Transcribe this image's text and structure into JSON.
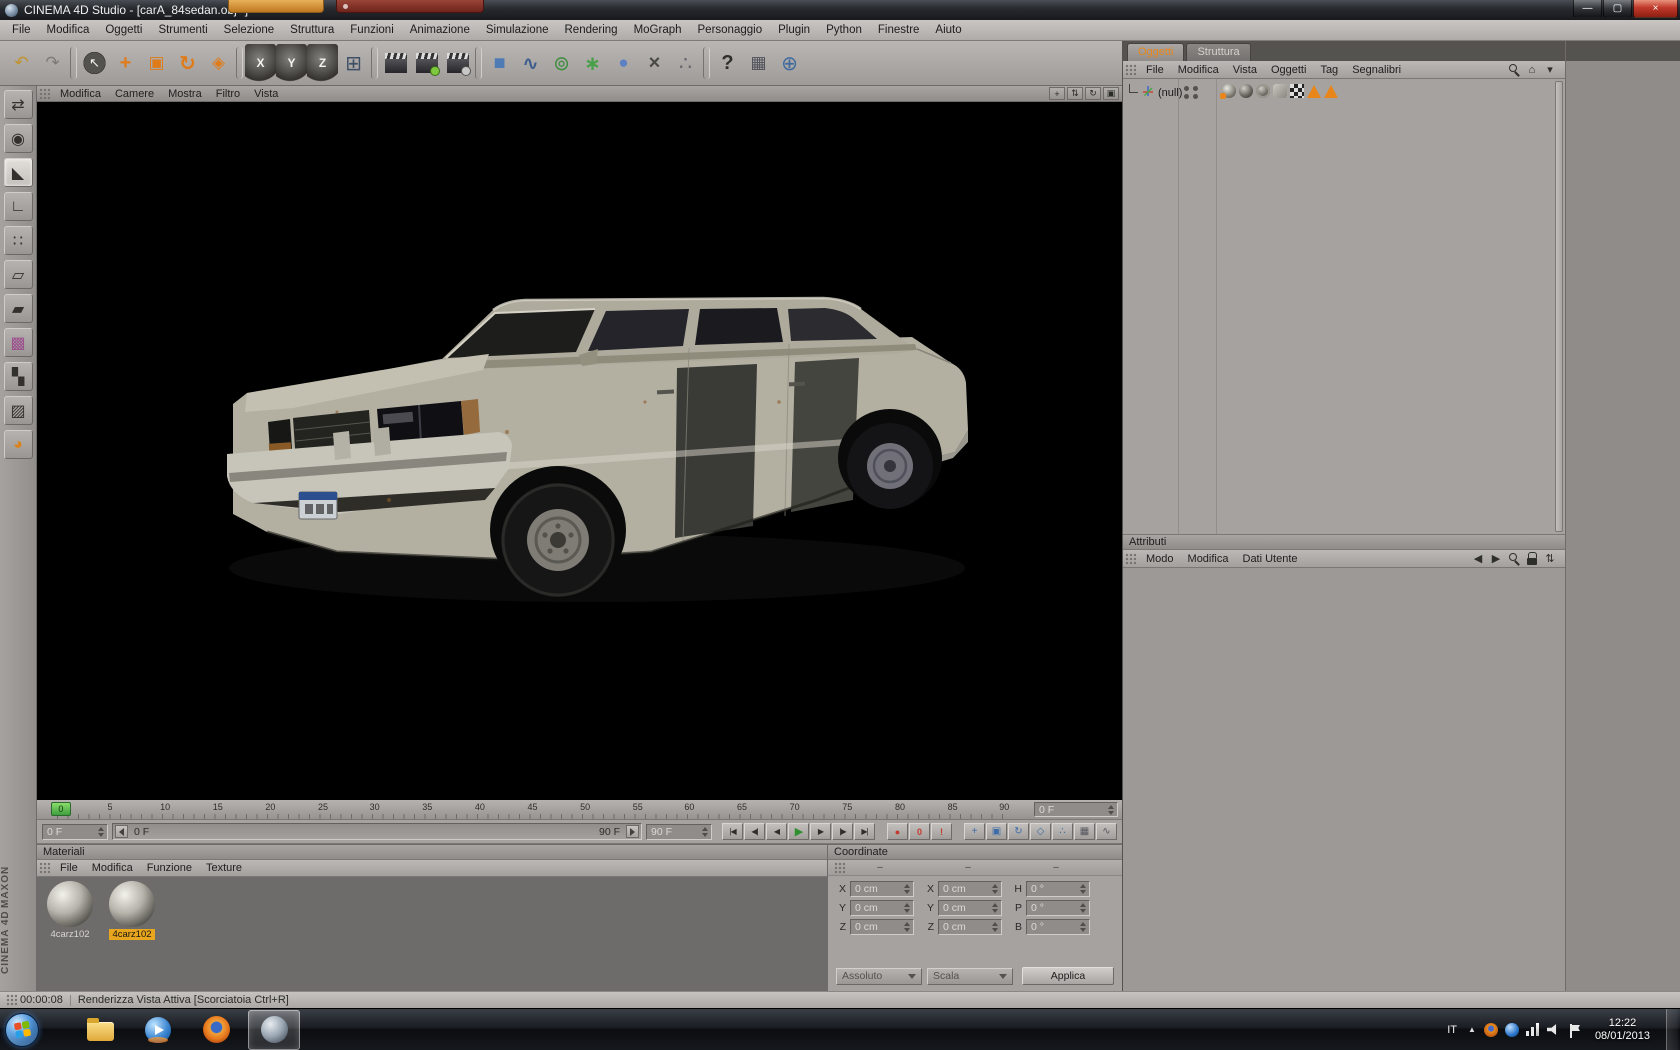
{
  "colors": {
    "accent_orange": "#e8861a",
    "playhead_green": "#4cae4c",
    "material_selected_yellow": "#e8a51e",
    "close_button_red": "#c0392b"
  },
  "titlebar": {
    "title": "CINEMA 4D Studio - [carA_84sedan.obj *]",
    "minimize_glyph": "—",
    "maximize_glyph": "▢",
    "close_glyph": "×"
  },
  "menubar": {
    "items": [
      "File",
      "Modifica",
      "Oggetti",
      "Strumenti",
      "Selezione",
      "Struttura",
      "Funzioni",
      "Animazione",
      "Simulazione",
      "Rendering",
      "MoGraph",
      "Personaggio",
      "Plugin",
      "Python",
      "Finestre",
      "Aiuto"
    ]
  },
  "toolbar": {
    "items": [
      {
        "name": "undo-button",
        "glyph": "↶",
        "color": "#c2922c",
        "kind": "tool"
      },
      {
        "name": "redo-button",
        "glyph": "↷",
        "color": "#7d7a76",
        "kind": "tool"
      },
      {
        "name": "toolbar-separator",
        "kind": "tool sep",
        "ia": "false"
      },
      {
        "name": "live-selection-tool",
        "glyph": "↖",
        "kind": "tool round"
      },
      {
        "name": "move-tool",
        "glyph": "+",
        "color": "#e07b1a",
        "kind": "tool big bold"
      },
      {
        "name": "scale-tool",
        "glyph": "▣",
        "color": "#e07b1a",
        "kind": "tool"
      },
      {
        "name": "rotate-tool",
        "glyph": "↻",
        "color": "#e07b1a",
        "kind": "tool big bold"
      },
      {
        "name": "last-used-tool",
        "glyph": "◈",
        "color": "#e07b1a",
        "kind": "tool"
      },
      {
        "name": "toolbar-separator",
        "kind": "tool sep",
        "ia": "false"
      },
      {
        "name": "lock-x-axis-button",
        "glyph": "X",
        "kind": "tool axis"
      },
      {
        "name": "lock-y-axis-button",
        "glyph": "Y",
        "kind": "tool axis"
      },
      {
        "name": "lock-z-axis-button",
        "glyph": "Z",
        "kind": "tool axis"
      },
      {
        "name": "coordinate-system-button",
        "glyph": "⊞",
        "color": "#3f4f66",
        "kind": "tool big"
      },
      {
        "name": "toolbar-separator",
        "kind": "tool sep",
        "ia": "false"
      },
      {
        "name": "render-view-button",
        "kind": "tool clapper"
      },
      {
        "name": "render-picture-viewer-button",
        "kind": "tool clapper dotg"
      },
      {
        "name": "render-settings-button",
        "kind": "tool clapper dots"
      },
      {
        "name": "toolbar-separator",
        "kind": "tool sep",
        "ia": "false"
      },
      {
        "name": "add-cube-button",
        "glyph": "■",
        "color": "#4e7bb4",
        "kind": "tool big"
      },
      {
        "name": "add-spline-button",
        "glyph": "∿",
        "color": "#3e5f8e",
        "kind": "tool big bold"
      },
      {
        "name": "add-subdivision-button",
        "glyph": "⊚",
        "color": "#3f8d3f",
        "kind": "tool big"
      },
      {
        "name": "add-array-button",
        "glyph": "∗",
        "color": "#49a049",
        "kind": "tool big bold"
      },
      {
        "name": "add-metaball-button",
        "glyph": "●",
        "color": "#5d7fc4",
        "kind": "tool"
      },
      {
        "name": "add-deformer-button",
        "glyph": "×",
        "color": "#4a4a46",
        "kind": "tool big bold"
      },
      {
        "name": "add-particles-button",
        "glyph": "∴",
        "color": "#63636b",
        "kind": "tool big"
      },
      {
        "name": "toolbar-separator",
        "kind": "tool sep",
        "ia": "false"
      },
      {
        "name": "help-button",
        "glyph": "?",
        "color": "#2e2e2a",
        "kind": "tool big bold"
      },
      {
        "name": "content-browser-button",
        "glyph": "▦",
        "color": "#50505a",
        "kind": "tool"
      },
      {
        "name": "online-help-button",
        "glyph": "⊕",
        "color": "#3e6a9e",
        "kind": "tool big"
      }
    ]
  },
  "left_toolbar": {
    "items": [
      {
        "name": "make-editable-button",
        "glyph": "⇄",
        "kind": "ltool"
      },
      {
        "name": "model-mode-button",
        "glyph": "◉",
        "kind": "ltool"
      },
      {
        "name": "workplane-mode-button",
        "glyph": "◣",
        "kind": "ltool selected"
      },
      {
        "name": "object-axis-mode-button",
        "glyph": "∟",
        "kind": "ltool"
      },
      {
        "name": "points-mode-button",
        "glyph": "∷",
        "kind": "ltool"
      },
      {
        "name": "edges-mode-button",
        "glyph": "▱",
        "kind": "ltool"
      },
      {
        "name": "polygons-mode-button",
        "glyph": "▰",
        "kind": "ltool"
      },
      {
        "name": "texture-mode-button",
        "glyph": "▩",
        "color": "#9c4e8e",
        "kind": "ltool"
      },
      {
        "name": "uvw-mode-button",
        "glyph": "▚",
        "kind": "ltool"
      },
      {
        "name": "texture-axis-mode-button",
        "glyph": "▨",
        "kind": "ltool"
      },
      {
        "name": "snap-settings-button",
        "glyph": "◕",
        "color": "#d8831e",
        "kind": "ltool"
      }
    ]
  },
  "viewport": {
    "menu": [
      "Modifica",
      "Camere",
      "Mostra",
      "Filtro",
      "Vista"
    ],
    "view_icons": [
      {
        "name": "pan-view-icon",
        "glyph": "+"
      },
      {
        "name": "zoom-view-icon",
        "glyph": "⇅"
      },
      {
        "name": "rotate-view-icon",
        "glyph": "↻"
      },
      {
        "name": "toggle-view-icon",
        "glyph": "▣"
      }
    ]
  },
  "timeline": {
    "ticks": [
      {
        "label": "0",
        "left": "2%"
      },
      {
        "label": "5",
        "left": "7.3%"
      },
      {
        "label": "10",
        "left": "12.6%"
      },
      {
        "label": "15",
        "left": "17.9%"
      },
      {
        "label": "20",
        "left": "23.2%"
      },
      {
        "label": "25",
        "left": "28.5%"
      },
      {
        "label": "30",
        "left": "33.7%"
      },
      {
        "label": "35",
        "left": "39%"
      },
      {
        "label": "40",
        "left": "44.3%"
      },
      {
        "label": "45",
        "left": "49.6%"
      },
      {
        "label": "50",
        "left": "54.9%"
      },
      {
        "label": "55",
        "left": "60.2%"
      },
      {
        "label": "60",
        "left": "65.4%"
      },
      {
        "label": "65",
        "left": "70.7%"
      },
      {
        "label": "70",
        "left": "76%"
      },
      {
        "label": "75",
        "left": "81.3%"
      },
      {
        "label": "80",
        "left": "86.6%"
      },
      {
        "label": "85",
        "left": "91.9%"
      },
      {
        "label": "90",
        "left": "97.1%"
      }
    ],
    "playhead": {
      "label": "0",
      "left": "2%"
    },
    "ruler_frame_field": "0 F",
    "current_frame_field": "0 F",
    "range_start_label": "0 F",
    "range_end_label": "90 F",
    "end_frame_field": "90 F",
    "transport": [
      {
        "name": "goto-start-button",
        "glyph": "|◀"
      },
      {
        "name": "previous-key-button",
        "glyph": "◀|"
      },
      {
        "name": "previous-frame-button",
        "glyph": "◀"
      },
      {
        "name": "play-forward-button",
        "glyph": "▶",
        "kind": "play"
      },
      {
        "name": "next-frame-button",
        "glyph": "▶"
      },
      {
        "name": "next-key-button",
        "glyph": "|▶"
      },
      {
        "name": "goto-end-button",
        "glyph": "▶|"
      }
    ],
    "record": [
      {
        "name": "record-objects-button",
        "glyph": "●",
        "kind": "rec"
      },
      {
        "name": "keyframe-selection-button",
        "glyph": "0",
        "kind": "rec"
      },
      {
        "name": "autokeying-button",
        "glyph": "!",
        "kind": "rec"
      }
    ],
    "key_toggles": [
      {
        "name": "key-position-toggle",
        "glyph": "+",
        "color": "#3e6ca8"
      },
      {
        "name": "key-scale-toggle",
        "glyph": "▣",
        "color": "#3e6ca8"
      },
      {
        "name": "key-rotation-toggle",
        "glyph": "↻",
        "color": "#3e6ca8"
      },
      {
        "name": "key-parameter-toggle",
        "glyph": "◇",
        "color": "#3e6ca8"
      },
      {
        "name": "key-pla-toggle",
        "glyph": "∴",
        "color": "#3e6ca8"
      },
      {
        "name": "timeline-grid-button",
        "glyph": "▦",
        "color": "#55555e"
      },
      {
        "name": "fcurve-mode-button",
        "glyph": "∿",
        "color": "#55555e"
      }
    ]
  },
  "materials": {
    "title": "Materiali",
    "menu": [
      "File",
      "Modifica",
      "Funzione",
      "Texture"
    ],
    "items": [
      {
        "name": "4carz102",
        "state": ""
      },
      {
        "name": "4carz102",
        "state": "selected"
      }
    ]
  },
  "coordinates": {
    "title": "Coordinate",
    "column_headers": [
      "–",
      "–",
      "–"
    ],
    "rows": [
      {
        "l1": "X",
        "v1": "0 cm",
        "l2": "X",
        "v2": "0 cm",
        "l3": "H",
        "v3": "0 °"
      },
      {
        "l1": "Y",
        "v1": "0 cm",
        "l2": "Y",
        "v2": "0 cm",
        "l3": "P",
        "v3": "0 °"
      },
      {
        "l1": "Z",
        "v1": "0 cm",
        "l2": "Z",
        "v2": "0 cm",
        "l3": "B",
        "v3": "0 °"
      }
    ],
    "mode_dropdown": "Assoluto",
    "scale_dropdown": "Scala",
    "apply_button": "Applica"
  },
  "object_manager": {
    "tabs": [
      {
        "name": "tab-oggetti",
        "label": "Oggetti",
        "state": "active"
      },
      {
        "name": "tab-struttura",
        "label": "Struttura",
        "state": ""
      }
    ],
    "menu": [
      "File",
      "Modifica",
      "Vista",
      "Oggetti",
      "Tag",
      "Segnalibri"
    ],
    "right_icons": [
      {
        "name": "search-icon",
        "kind": "gicon-search"
      },
      {
        "name": "home-icon",
        "glyph": "⌂"
      },
      {
        "name": "bookmark-menu-icon",
        "glyph": "▾"
      }
    ],
    "tree": [
      {
        "name": "(null)"
      }
    ],
    "tags": [
      {
        "name": "material-tag-icon",
        "kind": "tag tag-mat"
      },
      {
        "name": "texture-tag-icon",
        "kind": "tag tag-sphere"
      },
      {
        "name": "texture-tag-2-icon",
        "kind": "tag tag-sphere2"
      },
      {
        "name": "normal-tag-icon",
        "kind": "tag tag-grey"
      },
      {
        "name": "uvw-tag-icon",
        "kind": "tag tag-checker"
      },
      {
        "name": "phong-tag-icon",
        "kind": "tag tag-tri"
      },
      {
        "name": "display-tag-icon",
        "kind": "tag tag-tri"
      }
    ]
  },
  "attributes": {
    "title": "Attributi",
    "menu": [
      "Modo",
      "Modifica",
      "Dati Utente"
    ],
    "right_icons": [
      {
        "name": "history-back-icon",
        "glyph": "◀"
      },
      {
        "name": "history-forward-icon",
        "glyph": "▶"
      },
      {
        "name": "search-icon",
        "kind": "gicon-search"
      },
      {
        "name": "lock-icon",
        "kind": "gicon-lock"
      },
      {
        "name": "sync-icon",
        "glyph": "⇅"
      }
    ]
  },
  "statusbar": {
    "render_time": "00:00:08",
    "message": "Renderizza Vista Attiva [Scorciatoia Ctrl+R]"
  },
  "branding": {
    "line1": "MAXON",
    "line2": "CINEMA 4D"
  },
  "taskbar": {
    "apps": [
      {
        "name": "taskbar-explorer-button",
        "kind": "app-explorer",
        "state": ""
      },
      {
        "name": "taskbar-media-player-button",
        "kind": "app-wmp",
        "state": ""
      },
      {
        "name": "taskbar-firefox-button",
        "kind": "app-firefox",
        "state": ""
      },
      {
        "name": "taskbar-cinema4d-button",
        "kind": "app-c4d",
        "state": "active"
      }
    ],
    "tray": {
      "language": "IT",
      "expand_glyph": "▲",
      "icons": [
        {
          "name": "tray-firefox-icon",
          "kind": "tray-ff"
        },
        {
          "name": "tray-update-icon",
          "kind": "tray-blue"
        },
        {
          "name": "tray-network-icon",
          "kind": "tray-net"
        },
        {
          "name": "tray-volume-icon",
          "kind": "tray-vol"
        },
        {
          "name": "tray-action-center-icon",
          "kind": "tray-flag"
        }
      ],
      "clock_time": "12:22",
      "clock_date": "08/01/2013"
    }
  }
}
